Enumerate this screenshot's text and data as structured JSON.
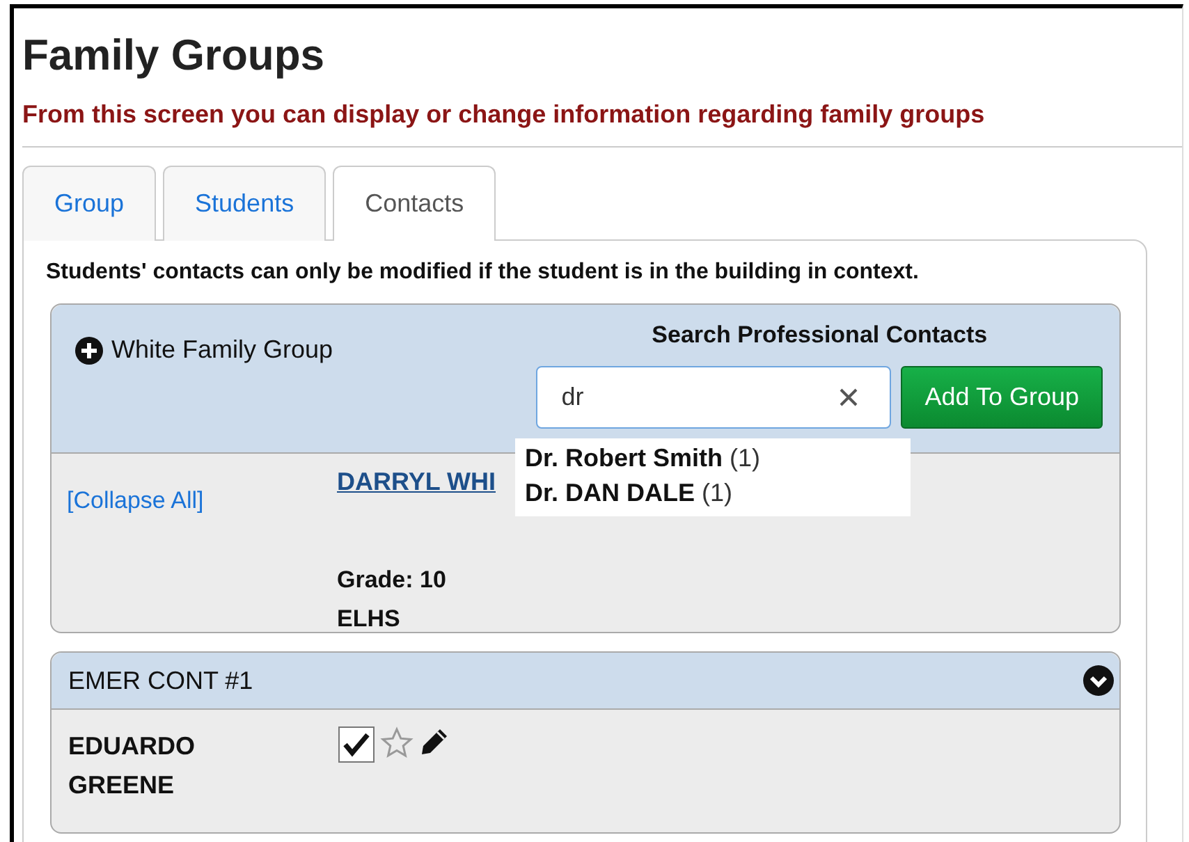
{
  "page": {
    "title": "Family Groups",
    "subtitle": "From this screen you can display or change information regarding family groups"
  },
  "tabs": [
    {
      "label": "Group",
      "selected": false
    },
    {
      "label": "Students",
      "selected": false
    },
    {
      "label": "Contacts",
      "selected": true
    }
  ],
  "notice": "Students' contacts can only be modified if the student is in the building in context.",
  "group_card": {
    "title": "White Family Group",
    "search_label": "Search Professional Contacts",
    "search_value": "dr",
    "add_button": "Add To Group",
    "collapse_link": "[Collapse All]",
    "student_link": "DARRYL WHI",
    "grade": "Grade: 10",
    "school": "ELHS",
    "suggestions": [
      {
        "name": "Dr. Robert Smith",
        "count": "(1)"
      },
      {
        "name": "Dr. DAN DALE",
        "count": "(1)"
      }
    ]
  },
  "contact_cards": [
    {
      "heading": "EMER CONT #1",
      "name_lines": [
        "EDUARDO",
        "GREENE"
      ],
      "checked": true,
      "starred": false
    }
  ]
}
